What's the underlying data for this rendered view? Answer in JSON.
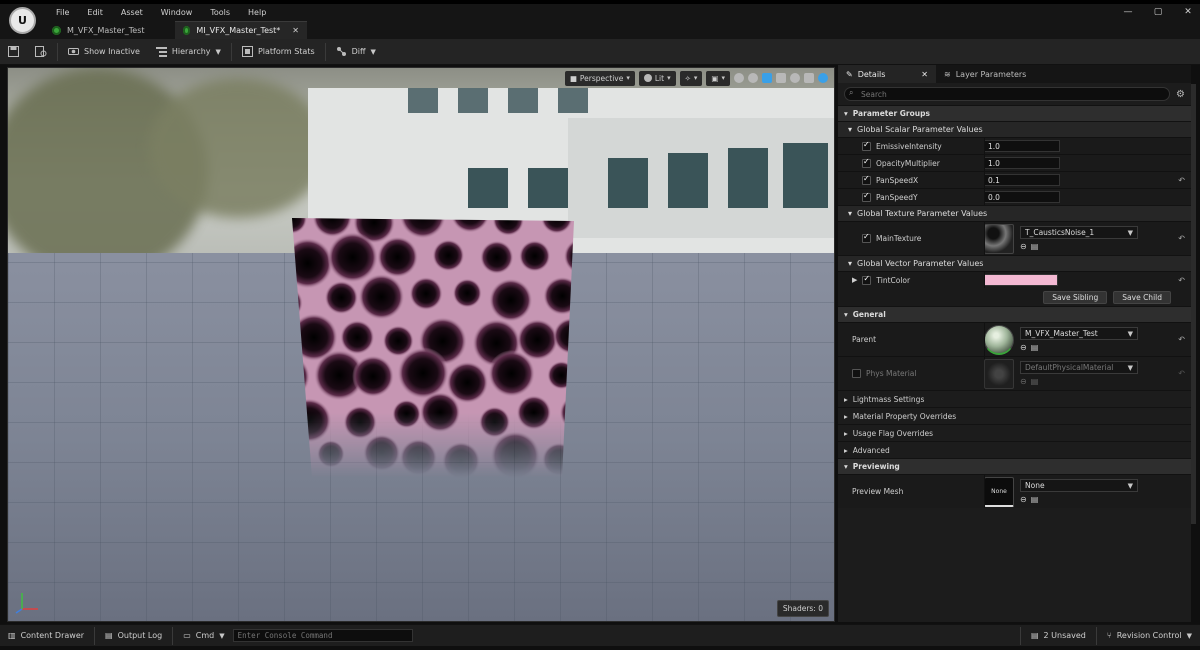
{
  "app": {
    "logo_text": "U"
  },
  "menu": [
    "File",
    "Edit",
    "Asset",
    "Window",
    "Tools",
    "Help"
  ],
  "window_controls": {
    "minimize": "—",
    "maximize": "▢",
    "close": "✕"
  },
  "tabs": [
    {
      "label": "M_VFX_Master_Test",
      "active": false
    },
    {
      "label": "MI_VFX_Master_Test*",
      "active": true,
      "close": "✕"
    }
  ],
  "toolbar": {
    "show_inactive": "Show Inactive",
    "hierarchy": "Hierarchy",
    "platform_stats": "Platform Stats",
    "diff": "Diff"
  },
  "viewport": {
    "perspective": "Perspective",
    "lit": "Lit",
    "shaders": "Shaders: 0"
  },
  "details": {
    "tab_details": "Details",
    "tab_layer": "Layer Parameters",
    "search_placeholder": "Search",
    "parameter_groups": "Parameter Groups",
    "scalar_group": "Global Scalar Parameter Values",
    "scalars": [
      {
        "name": "EmissiveIntensity",
        "value": "1.0",
        "reset": false
      },
      {
        "name": "OpacityMultiplier",
        "value": "1.0",
        "reset": false
      },
      {
        "name": "PanSpeedX",
        "value": "0.1",
        "reset": true
      },
      {
        "name": "PanSpeedY",
        "value": "0.0",
        "reset": false
      }
    ],
    "texture_group": "Global Texture Parameter Values",
    "texture": {
      "name": "MainTexture",
      "value": "T_CausticsNoise_1"
    },
    "vector_group": "Global Vector Parameter Values",
    "vector": {
      "name": "TintColor",
      "color": "#f3b8d2"
    },
    "save_sibling": "Save Sibling",
    "save_child": "Save Child",
    "general": "General",
    "parent_label": "Parent",
    "parent_value": "M_VFX_Master_Test",
    "phys_label": "Phys Material",
    "phys_value": "DefaultPhysicalMaterial",
    "lightmass": "Lightmass Settings",
    "mat_overrides": "Material Property Overrides",
    "usage_overrides": "Usage Flag Overrides",
    "advanced": "Advanced",
    "previewing": "Previewing",
    "preview_mesh_label": "Preview Mesh",
    "preview_mesh_thumb": "None",
    "preview_mesh_value": "None"
  },
  "bottombar": {
    "content_drawer": "Content Drawer",
    "output_log": "Output Log",
    "cmd": "Cmd",
    "console_placeholder": "Enter Console Command",
    "unsaved": "2 Unsaved",
    "revision_control": "Revision Control"
  }
}
